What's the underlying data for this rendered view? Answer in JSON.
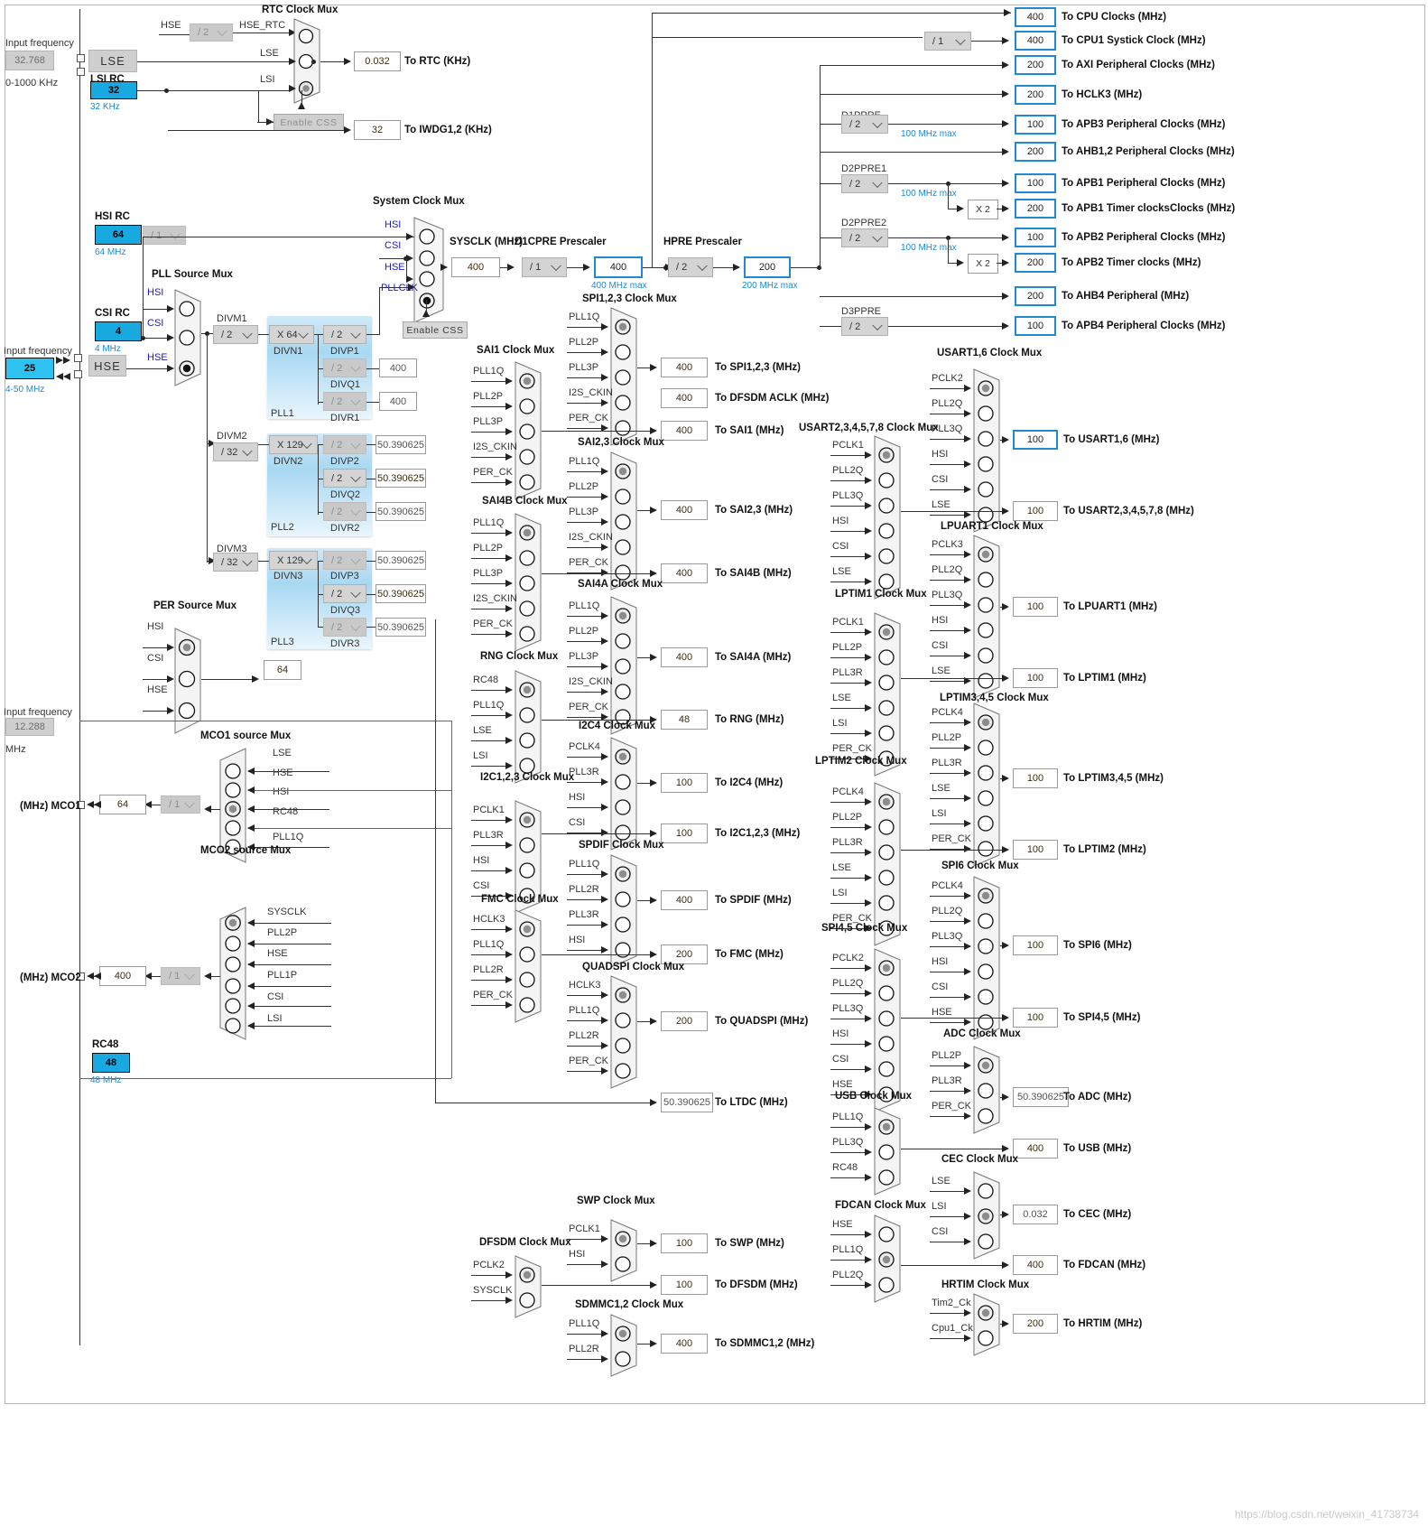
{
  "inputs": {
    "lse": {
      "caption": "Input frequency",
      "value": "32.768",
      "range": "0-1000 KHz",
      "name": "LSE"
    },
    "lsi": {
      "title": "LSI RC",
      "value": "32",
      "note": "32 KHz"
    },
    "hsi": {
      "title": "HSI RC",
      "value": "64",
      "note": "64 MHz",
      "div": "/ 1"
    },
    "csi": {
      "title": "CSI RC",
      "value": "4",
      "note": "4 MHz"
    },
    "hse": {
      "caption": "Input frequency",
      "value": "25",
      "range": "4-50 MHz",
      "name": "HSE"
    },
    "i2s": {
      "caption": "Input frequency",
      "value": "12.288",
      "unit": "MHz"
    },
    "rc48": {
      "title": "RC48",
      "value": "48",
      "note": "48 MHz"
    }
  },
  "rtc": {
    "title": "RTC Clock Mux",
    "hse_label": "HSE",
    "hse_div": "/ 2",
    "hse_rtc": "HSE_RTC",
    "inputs": [
      "HSE_RTC",
      "LSE",
      "LSI"
    ],
    "selected": 2,
    "enable_css": "Enable CSS",
    "out_rtc": {
      "value": "0.032",
      "label": "To RTC (KHz)"
    },
    "out_iwdg": {
      "value": "32",
      "label": "To IWDG1,2 (KHz)"
    }
  },
  "pll_source_mux": {
    "title": "PLL Source Mux",
    "inputs": [
      "HSI",
      "CSI",
      "HSE"
    ],
    "selected": 2
  },
  "system_clock_mux": {
    "title": "System Clock Mux",
    "inputs": [
      "HSI",
      "CSI",
      "HSE",
      "PLLCLK"
    ],
    "selected": 3,
    "enable_css": "Enable CSS"
  },
  "pll1": {
    "name": "PLL1",
    "divm": {
      "label": "DIVM1",
      "value": "/ 2"
    },
    "divn": {
      "label": "DIVN1",
      "value": "X 64"
    },
    "divp": {
      "label": "DIVP1",
      "value": "/ 2",
      "enabled": true
    },
    "divq": {
      "label": "DIVQ1",
      "value": "/ 2",
      "out": "400",
      "enabled": false
    },
    "divr": {
      "label": "DIVR1",
      "value": "/ 2",
      "out": "400",
      "enabled": false
    }
  },
  "pll2": {
    "name": "PLL2",
    "divm": {
      "label": "DIVM2",
      "value": "/ 32"
    },
    "divn": {
      "label": "DIVN2",
      "value": "X 129"
    },
    "divp": {
      "label": "DIVP2",
      "value": "/ 2",
      "out": "50.390625",
      "enabled": false
    },
    "divq": {
      "label": "DIVQ2",
      "value": "/ 2",
      "out": "50.390625",
      "enabled": true
    },
    "divr": {
      "label": "DIVR2",
      "value": "/ 2",
      "out": "50.390625",
      "enabled": false
    }
  },
  "pll3": {
    "name": "PLL3",
    "divm": {
      "label": "DIVM3",
      "value": "/ 32"
    },
    "divn": {
      "label": "DIVN3",
      "value": "X 129"
    },
    "divp": {
      "label": "DIVP3",
      "value": "/ 2",
      "out": "50.390625",
      "enabled": false
    },
    "divq": {
      "label": "DIVQ3",
      "value": "/ 2",
      "out": "50.390625",
      "enabled": true
    },
    "divr": {
      "label": "DIVR3",
      "value": "/ 2",
      "out": "50.390625",
      "enabled": false
    }
  },
  "sysclk": {
    "label": "SYSCLK (MHz)",
    "value": "400"
  },
  "d1cpre": {
    "label": "D1CPRE Prescaler",
    "value": "/ 1",
    "out": "400",
    "max": "400 MHz max"
  },
  "hpre": {
    "label": "HPRE Prescaler",
    "value": "/ 2",
    "out": "200",
    "max": "200 MHz max"
  },
  "prescalers": {
    "cpu1_systick": "/ 1",
    "d1ppre": {
      "label": "D1PPRE",
      "value": "/ 2",
      "max": "100 MHz max"
    },
    "d2ppre1": {
      "label": "D2PPRE1",
      "value": "/ 2",
      "max": "100 MHz max"
    },
    "d2ppre2": {
      "label": "D2PPRE2",
      "value": "/ 2",
      "max": "100 MHz max"
    },
    "d3ppre": {
      "label": "D3PPRE",
      "value": "/ 2"
    },
    "x2": "X 2"
  },
  "bus_outputs": [
    {
      "value": "400",
      "label": "To CPU Clocks (MHz)"
    },
    {
      "value": "400",
      "label": "To CPU1 Systick Clock (MHz)"
    },
    {
      "value": "200",
      "label": "To AXI Peripheral Clocks (MHz)"
    },
    {
      "value": "200",
      "label": "To HCLK3 (MHz)"
    },
    {
      "value": "100",
      "label": "To APB3 Peripheral Clocks (MHz)"
    },
    {
      "value": "200",
      "label": "To AHB1,2 Peripheral Clocks (MHz)"
    },
    {
      "value": "100",
      "label": "To APB1 Peripheral Clocks (MHz)"
    },
    {
      "value": "200",
      "label": "To APB1 Timer clocksClocks (MHz)"
    },
    {
      "value": "100",
      "label": "To APB2 Peripheral Clocks (MHz)"
    },
    {
      "value": "200",
      "label": "To APB2 Timer clocks (MHz)"
    },
    {
      "value": "200",
      "label": "To AHB4 Peripheral (MHz)"
    },
    {
      "value": "100",
      "label": "To APB4 Peripheral Clocks (MHz)"
    }
  ],
  "per_source_mux": {
    "title": "PER Source Mux",
    "inputs": [
      "HSI",
      "CSI",
      "HSE"
    ],
    "selected": 0,
    "out": "64"
  },
  "mco1": {
    "title": "MCO1 source Mux",
    "inputs": [
      "LSE",
      "HSE",
      "HSI",
      "RC48",
      "PLL1Q"
    ],
    "selected": 2,
    "div": "/ 1",
    "value": "64",
    "label": "(MHz) MCO1"
  },
  "mco2": {
    "title": "MCO2 source Mux",
    "inputs": [
      "SYSCLK",
      "PLL2P",
      "HSE",
      "PLL1P",
      "CSI",
      "LSI"
    ],
    "selected": 0,
    "div": "/ 1",
    "value": "400",
    "label": "(MHz) MCO2"
  },
  "ltdc": {
    "value": "50.390625",
    "label": "To LTDC (MHz)"
  },
  "muxes": [
    {
      "id": "spi123",
      "title": "SPI1,2,3 Clock Mux",
      "inputs": [
        "PLL1Q",
        "PLL2P",
        "PLL3P",
        "I2S_CKIN",
        "PER_CK"
      ],
      "selected": 0,
      "out": "400",
      "out_label": "To SPI1,2,3 (MHz)"
    },
    {
      "id": "dfsdm_aclk",
      "title": "",
      "inputs": [],
      "selected": -1,
      "out": "400",
      "out_label": "To DFSDM ACLK (MHz)"
    },
    {
      "id": "sai1",
      "title": "SAI1 Clock Mux",
      "inputs": [
        "PLL1Q",
        "PLL2P",
        "PLL3P",
        "I2S_CKIN",
        "PER_CK"
      ],
      "selected": 0,
      "out": "400",
      "out_label": "To SAI1 (MHz)"
    },
    {
      "id": "sai23",
      "title": "SAI2,3 Clock Mux",
      "inputs": [
        "PLL1Q",
        "PLL2P",
        "PLL3P",
        "I2S_CKIN",
        "PER_CK"
      ],
      "selected": 0,
      "out": "400",
      "out_label": "To SAI2,3 (MHz)"
    },
    {
      "id": "sai4b",
      "title": "SAI4B Clock Mux",
      "inputs": [
        "PLL1Q",
        "PLL2P",
        "PLL3P",
        "I2S_CKIN",
        "PER_CK"
      ],
      "selected": 0,
      "out": "400",
      "out_label": "To SAI4B (MHz)"
    },
    {
      "id": "sai4a",
      "title": "SAI4A Clock Mux",
      "inputs": [
        "PLL1Q",
        "PLL2P",
        "PLL3P",
        "I2S_CKIN",
        "PER_CK"
      ],
      "selected": 0,
      "out": "400",
      "out_label": "To SAI4A (MHz)"
    },
    {
      "id": "rng",
      "title": "RNG Clock Mux",
      "inputs": [
        "RC48",
        "PLL1Q",
        "LSE",
        "LSI"
      ],
      "selected": 0,
      "out": "48",
      "out_label": "To RNG (MHz)"
    },
    {
      "id": "i2c4",
      "title": "I2C4 Clock Mux",
      "inputs": [
        "PCLK4",
        "PLL3R",
        "HSI",
        "CSI"
      ],
      "selected": 0,
      "out": "100",
      "out_label": "To I2C4 (MHz)"
    },
    {
      "id": "i2c123",
      "title": "I2C1,2,3 Clock Mux",
      "inputs": [
        "PCLK1",
        "PLL3R",
        "HSI",
        "CSI"
      ],
      "selected": 0,
      "out": "100",
      "out_label": "To I2C1,2,3 (MHz)"
    },
    {
      "id": "spdif",
      "title": "SPDIF Clock Mux",
      "inputs": [
        "PLL1Q",
        "PLL2R",
        "PLL3R",
        "HSI"
      ],
      "selected": 0,
      "out": "400",
      "out_label": "To SPDIF (MHz)"
    },
    {
      "id": "fmc",
      "title": "FMC Clock Mux",
      "inputs": [
        "HCLK3",
        "PLL1Q",
        "PLL2R",
        "PER_CK"
      ],
      "selected": 0,
      "out": "200",
      "out_label": "To FMC (MHz)"
    },
    {
      "id": "quadspi",
      "title": "QUADSPI Clock Mux",
      "inputs": [
        "HCLK3",
        "PLL1Q",
        "PLL2R",
        "PER_CK"
      ],
      "selected": 0,
      "out": "200",
      "out_label": "To QUADSPI (MHz)"
    },
    {
      "id": "usart16",
      "title": "USART1,6 Clock Mux",
      "inputs": [
        "PCLK2",
        "PLL2Q",
        "PLL3Q",
        "HSI",
        "CSI",
        "LSE"
      ],
      "selected": 0,
      "out": "100",
      "out_label": "To USART1,6 (MHz)"
    },
    {
      "id": "usart234578",
      "title": "USART2,3,4,5,7,8 Clock Mux",
      "inputs": [
        "PCLK1",
        "PLL2Q",
        "PLL3Q",
        "HSI",
        "CSI",
        "LSE"
      ],
      "selected": 0,
      "out": "100",
      "out_label": "To USART2,3,4,5,7,8 (MHz)"
    },
    {
      "id": "lpuart1",
      "title": "LPUART1 Clock Mux",
      "inputs": [
        "PCLK3",
        "PLL2Q",
        "PLL3Q",
        "HSI",
        "CSI",
        "LSE"
      ],
      "selected": 0,
      "out": "100",
      "out_label": "To LPUART1 (MHz)"
    },
    {
      "id": "lptim1",
      "title": "LPTIM1 Clock Mux",
      "inputs": [
        "PCLK1",
        "PLL2P",
        "PLL3R",
        "LSE",
        "LSI",
        "PER_CK"
      ],
      "selected": 0,
      "out": "100",
      "out_label": "To LPTIM1 (MHz)"
    },
    {
      "id": "lptim345",
      "title": "LPTIM3,4,5 Clock Mux",
      "inputs": [
        "PCLK4",
        "PLL2P",
        "PLL3R",
        "LSE",
        "LSI",
        "PER_CK"
      ],
      "selected": 0,
      "out": "100",
      "out_label": "To LPTIM3,4,5 (MHz)"
    },
    {
      "id": "lptim2",
      "title": "LPTIM2 Clock Mux",
      "inputs": [
        "PCLK4",
        "PLL2P",
        "PLL3R",
        "LSE",
        "LSI",
        "PER_CK"
      ],
      "selected": 0,
      "out": "100",
      "out_label": "To LPTIM2 (MHz)"
    },
    {
      "id": "spi6",
      "title": "SPI6 Clock Mux",
      "inputs": [
        "PCLK4",
        "PLL2Q",
        "PLL3Q",
        "HSI",
        "CSI",
        "HSE"
      ],
      "selected": 0,
      "out": "100",
      "out_label": "To SPI6 (MHz)"
    },
    {
      "id": "spi45",
      "title": "SPI4,5 Clock Mux",
      "inputs": [
        "PCLK2",
        "PLL2Q",
        "PLL3Q",
        "HSI",
        "CSI",
        "HSE"
      ],
      "selected": 0,
      "out": "100",
      "out_label": "To SPI4,5 (MHz)"
    },
    {
      "id": "adc",
      "title": "ADC Clock Mux",
      "inputs": [
        "PLL2P",
        "PLL3R",
        "PER_CK"
      ],
      "selected": 0,
      "out": "50.390625",
      "out_label": "To ADC (MHz)"
    },
    {
      "id": "usb",
      "title": "USB Clock Mux",
      "inputs": [
        "PLL1Q",
        "PLL3Q",
        "RC48"
      ],
      "selected": 0,
      "out": "400",
      "out_label": "To USB (MHz)"
    },
    {
      "id": "cec",
      "title": "CEC Clock Mux",
      "inputs": [
        "LSE",
        "LSI",
        "CSI"
      ],
      "selected": 1,
      "out": "0.032",
      "out_label": "To CEC (MHz)"
    },
    {
      "id": "fdcan",
      "title": "FDCAN Clock Mux",
      "inputs": [
        "HSE",
        "PLL1Q",
        "PLL2Q"
      ],
      "selected": 1,
      "out": "400",
      "out_label": "To FDCAN (MHz)"
    },
    {
      "id": "hrtim",
      "title": "HRTIM Clock Mux",
      "inputs": [
        "Tim2_Ck",
        "Cpu1_Ck"
      ],
      "selected": 0,
      "out": "200",
      "out_label": "To HRTIM (MHz)"
    },
    {
      "id": "swp",
      "title": "SWP Clock Mux",
      "inputs": [
        "PCLK1",
        "HSI"
      ],
      "selected": 0,
      "out": "100",
      "out_label": "To SWP (MHz)"
    },
    {
      "id": "dfsdm",
      "title": "DFSDM Clock Mux",
      "inputs": [
        "PCLK2",
        "SYSCLK"
      ],
      "selected": 0,
      "out": "100",
      "out_label": "To DFSDM (MHz)"
    },
    {
      "id": "sdmmc12",
      "title": "SDMMC1,2 Clock Mux",
      "inputs": [
        "PLL1Q",
        "PLL2R"
      ],
      "selected": 0,
      "out": "400",
      "out_label": "To SDMMC1,2 (MHz)"
    }
  ],
  "watermark": "https://blog.csdn.net/weixin_41738734",
  "colors": {
    "accent": "#1f8ad2",
    "source": "#17a9e0",
    "signal": "#1b1bb3",
    "wire": "#333333"
  }
}
